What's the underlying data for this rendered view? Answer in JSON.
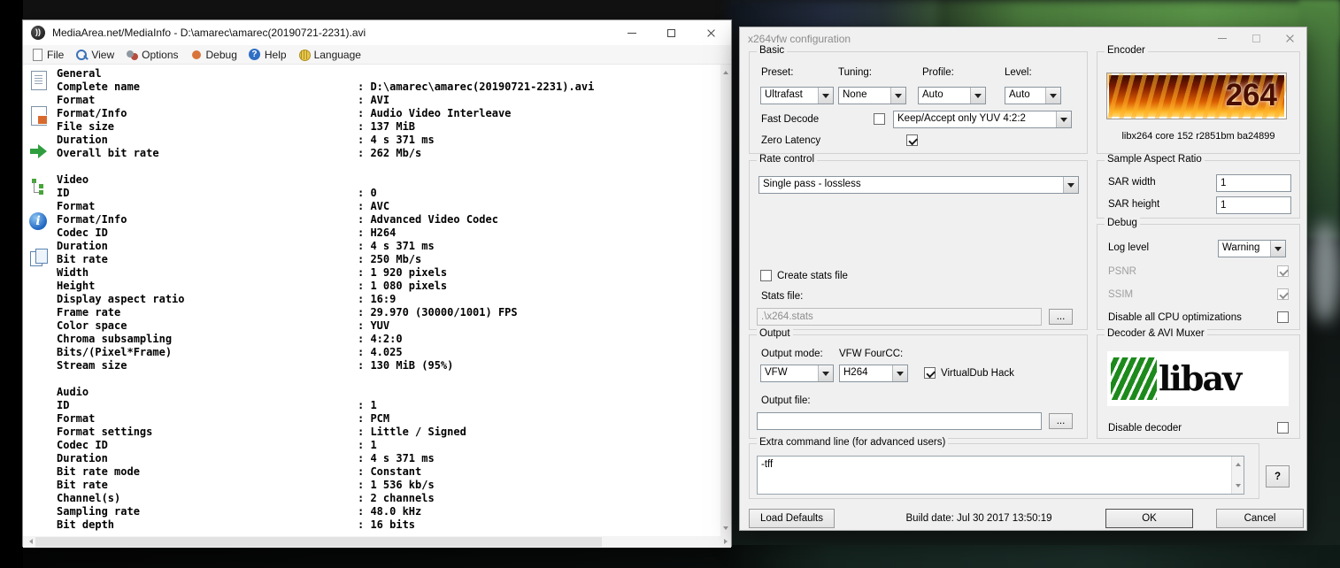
{
  "desktop": {
    "colors": {
      "grass": "#4d8a3f",
      "dialog_bg": "#f0f0f0",
      "titlebar_active_text": "#000000",
      "titlebar_inactive_text": "#8c8c8c",
      "libav_green": "#1c8a1c",
      "x264_flame_orange": "#d85c00"
    }
  },
  "mediainfo": {
    "title": "MediaArea.net/MediaInfo - D:\\amarec\\amarec(20190721-2231).avi",
    "menu": [
      {
        "label": "File",
        "icon": "file-icon"
      },
      {
        "label": "View",
        "icon": "view-icon"
      },
      {
        "label": "Options",
        "icon": "options-icon"
      },
      {
        "label": "Debug",
        "icon": "debug-icon"
      },
      {
        "label": "Help",
        "icon": "help-icon"
      },
      {
        "label": "Language",
        "icon": "language-icon"
      }
    ],
    "sidebar_icons": [
      "export-text-icon",
      "export-html-icon",
      "goto-icon",
      "tree-view-icon",
      "info-icon",
      "compare-icon"
    ],
    "rows": [
      {
        "label": "General",
        "value": ""
      },
      {
        "label": "Complete name",
        "value": ": D:\\amarec\\amarec(20190721-2231).avi"
      },
      {
        "label": "Format",
        "value": ": AVI"
      },
      {
        "label": "Format/Info",
        "value": ": Audio Video Interleave"
      },
      {
        "label": "File size",
        "value": ": 137 MiB"
      },
      {
        "label": "Duration",
        "value": ": 4 s 371 ms"
      },
      {
        "label": "Overall bit rate",
        "value": ": 262 Mb/s"
      },
      {
        "label": "",
        "value": ""
      },
      {
        "label": "Video",
        "value": ""
      },
      {
        "label": "ID",
        "value": ": 0"
      },
      {
        "label": "Format",
        "value": ": AVC"
      },
      {
        "label": "Format/Info",
        "value": ": Advanced Video Codec"
      },
      {
        "label": "Codec ID",
        "value": ": H264"
      },
      {
        "label": "Duration",
        "value": ": 4 s 371 ms"
      },
      {
        "label": "Bit rate",
        "value": ": 250 Mb/s"
      },
      {
        "label": "Width",
        "value": ": 1 920 pixels"
      },
      {
        "label": "Height",
        "value": ": 1 080 pixels"
      },
      {
        "label": "Display aspect ratio",
        "value": ": 16:9"
      },
      {
        "label": "Frame rate",
        "value": ": 29.970 (30000/1001) FPS"
      },
      {
        "label": "Color space",
        "value": ": YUV"
      },
      {
        "label": "Chroma subsampling",
        "value": ": 4:2:0"
      },
      {
        "label": "Bits/(Pixel*Frame)",
        "value": ": 4.025"
      },
      {
        "label": "Stream size",
        "value": ": 130 MiB (95%)"
      },
      {
        "label": "",
        "value": ""
      },
      {
        "label": "Audio",
        "value": ""
      },
      {
        "label": "ID",
        "value": ": 1"
      },
      {
        "label": "Format",
        "value": ": PCM"
      },
      {
        "label": "Format settings",
        "value": ": Little / Signed"
      },
      {
        "label": "Codec ID",
        "value": ": 1"
      },
      {
        "label": "Duration",
        "value": ": 4 s 371 ms"
      },
      {
        "label": "Bit rate mode",
        "value": ": Constant"
      },
      {
        "label": "Bit rate",
        "value": ": 1 536 kb/s"
      },
      {
        "label": "Channel(s)",
        "value": ": 2 channels"
      },
      {
        "label": "Sampling rate",
        "value": ": 48.0 kHz"
      },
      {
        "label": "Bit depth",
        "value": ": 16 bits"
      }
    ]
  },
  "x264": {
    "title": "x264vfw configuration",
    "groups": {
      "basic": {
        "label": "Basic",
        "preset_label": "Preset:",
        "preset_value": "Ultrafast",
        "tuning_label": "Tuning:",
        "tuning_value": "None",
        "profile_label": "Profile:",
        "profile_value": "Auto",
        "level_label": "Level:",
        "level_value": "Auto",
        "fast_decode_label": "Fast Decode",
        "fast_decode_checked": false,
        "yuv_value": "Keep/Accept only YUV 4:2:2",
        "zero_latency_label": "Zero Latency",
        "zero_latency_checked": true
      },
      "encoder": {
        "label": "Encoder",
        "logo_text": "264",
        "caption": "libx264 core 152 r2851bm ba24899"
      },
      "rate_control": {
        "label": "Rate control",
        "mode_value": "Single pass - lossless",
        "create_stats_label": "Create stats file",
        "create_stats_checked": false,
        "stats_file_label": "Stats file:",
        "stats_file_value": ".\\x264.stats",
        "browse_label": "..."
      },
      "sar": {
        "label": "Sample Aspect Ratio",
        "width_label": "SAR width",
        "width_value": "1",
        "height_label": "SAR height",
        "height_value": "1"
      },
      "debug": {
        "label": "Debug",
        "log_level_label": "Log level",
        "log_level_value": "Warning",
        "psnr_label": "PSNR",
        "psnr_checked": true,
        "ssim_label": "SSIM",
        "ssim_checked": true,
        "cpu_label": "Disable all CPU optimizations",
        "cpu_checked": false
      },
      "output": {
        "label": "Output",
        "mode_label": "Output mode:",
        "mode_value": "VFW",
        "fourcc_label": "VFW FourCC:",
        "fourcc_value": "H264",
        "vdub_label": "VirtualDub Hack",
        "vdub_checked": true,
        "file_label": "Output file:",
        "file_value": "",
        "browse_label": "..."
      },
      "decoder": {
        "label": "Decoder & AVI Muxer",
        "logo_text": "libav",
        "disable_label": "Disable decoder",
        "disable_checked": false
      },
      "extra": {
        "label": "Extra command line (for advanced users)",
        "value": "-tff",
        "help_label": "?"
      }
    },
    "footer": {
      "load_defaults": "Load Defaults",
      "build_date": "Build date: Jul 30 2017 13:50:19",
      "ok": "OK",
      "cancel": "Cancel"
    }
  }
}
